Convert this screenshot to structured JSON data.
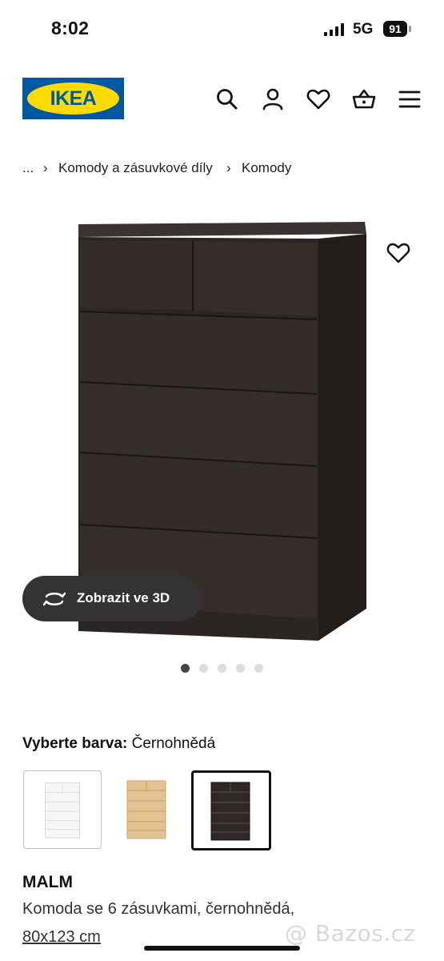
{
  "status_bar": {
    "time": "8:02",
    "network": "5G",
    "battery": "91"
  },
  "header": {
    "logo_text": "IKEA",
    "icons": [
      "search-icon",
      "account-icon",
      "favorites-icon",
      "cart-icon",
      "menu-icon"
    ]
  },
  "breadcrumb": {
    "items": [
      "...",
      "Komody a zásuvkové díly",
      "Komody"
    ]
  },
  "gallery": {
    "view_3d_label": "Zobrazit ve 3D",
    "dots_total": 5,
    "active_dot": 1
  },
  "color_picker": {
    "label": "Vyberte barva:",
    "selected_value": "Černohnědá",
    "options": [
      "white",
      "white-stained oak",
      "black-brown"
    ],
    "selected_index": 2
  },
  "product": {
    "name": "MALM",
    "description": "Komoda se 6 zásuvkami, černohnědá,",
    "size": "80x123 cm"
  },
  "watermark": "@ Bazos.cz",
  "colors": {
    "ikea_blue": "#0058a3",
    "ikea_yellow": "#ffdb00",
    "dresser": "#2f2826"
  }
}
